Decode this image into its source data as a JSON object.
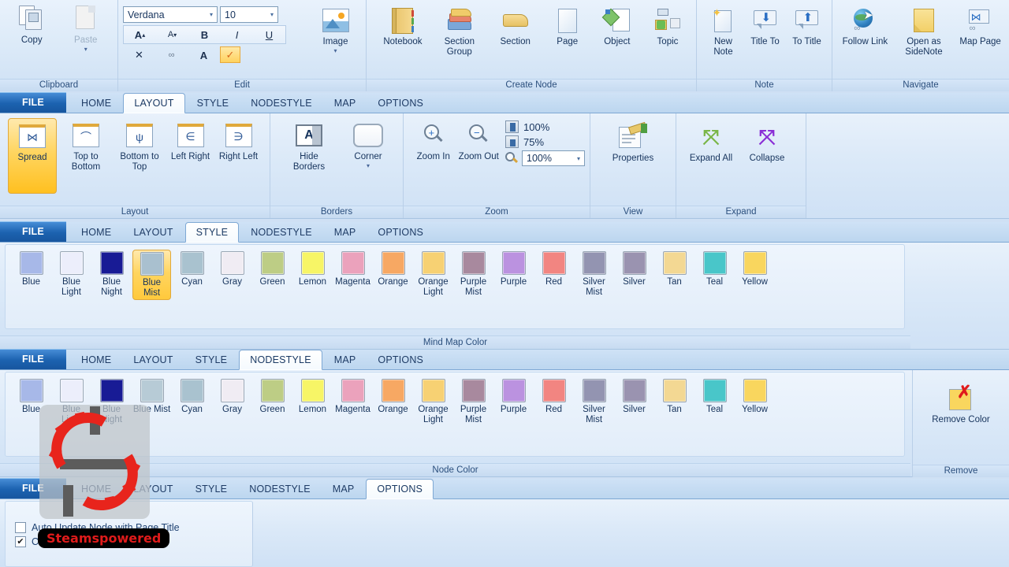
{
  "top_ribbon": {
    "groups": [
      {
        "label": "Clipboard",
        "items": [
          {
            "label": "Copy",
            "icon": "copy-icon",
            "disabled": false
          },
          {
            "label": "Paste",
            "icon": "paste-icon",
            "disabled": true,
            "has_dropdown": true
          }
        ]
      },
      {
        "label": "Edit",
        "font_name": "Verdana",
        "font_size": "10",
        "buttons": [
          {
            "name": "grow-font",
            "glyph": "A˘"
          },
          {
            "name": "shrink-font",
            "glyph": "A˘"
          },
          {
            "name": "bold",
            "glyph": "B"
          },
          {
            "name": "italic",
            "glyph": "I"
          },
          {
            "name": "underline",
            "glyph": "U"
          },
          {
            "name": "delete",
            "glyph": "✕"
          },
          {
            "name": "link",
            "glyph": "∞"
          },
          {
            "name": "font-color",
            "glyph": "A"
          },
          {
            "name": "check",
            "glyph": "✓",
            "selected": true
          }
        ],
        "image_label": "Image"
      },
      {
        "label": "Create Node",
        "items": [
          {
            "label": "Notebook",
            "icon": "notebook-icon"
          },
          {
            "label": "Section Group",
            "icon": "section-group-icon"
          },
          {
            "label": "Section",
            "icon": "section-icon"
          },
          {
            "label": "Page",
            "icon": "page-icon"
          },
          {
            "label": "Object",
            "icon": "object-icon"
          },
          {
            "label": "Topic",
            "icon": "topic-icon"
          }
        ]
      },
      {
        "label": "Note",
        "items": [
          {
            "label": "New Note",
            "icon": "new-note-icon"
          },
          {
            "label": "Title To",
            "icon": "title-to-icon"
          },
          {
            "label": "To Title",
            "icon": "to-title-icon"
          }
        ]
      },
      {
        "label": "Navigate",
        "items": [
          {
            "label": "Follow Link",
            "icon": "follow-link-icon"
          },
          {
            "label": "Open as SideNote",
            "icon": "open-as-sidenote-icon"
          },
          {
            "label": "Map Page",
            "icon": "map-page-icon"
          }
        ]
      }
    ]
  },
  "tabs": [
    "FILE",
    "HOME",
    "LAYOUT",
    "STYLE",
    "NODESTYLE",
    "MAP",
    "OPTIONS"
  ],
  "layout_ribbon": {
    "active_tab": "LAYOUT",
    "groups": [
      {
        "label": "Layout",
        "items": [
          {
            "label": "Spread",
            "icon": "spread-icon",
            "selected": true
          },
          {
            "label": "Top to Bottom",
            "icon": "top-to-bottom-icon"
          },
          {
            "label": "Bottom to Top",
            "icon": "bottom-to-top-icon"
          },
          {
            "label": "Left Right",
            "icon": "left-right-icon"
          },
          {
            "label": "Right Left",
            "icon": "right-left-icon"
          }
        ]
      },
      {
        "label": "Borders",
        "items": [
          {
            "label": "Hide Borders",
            "icon": "hide-borders-icon"
          },
          {
            "label": "Corner",
            "icon": "corner-icon",
            "has_dropdown": true
          }
        ]
      },
      {
        "label": "Zoom",
        "items": [
          {
            "label": "Zoom In",
            "icon": "zoom-in-icon"
          },
          {
            "label": "Zoom Out",
            "icon": "zoom-out-icon"
          }
        ],
        "presets": [
          {
            "label": "100%",
            "icon": "one-page-icon"
          },
          {
            "label": "75%",
            "icon": "page-width-icon"
          }
        ],
        "zoom_combo_value": "100%",
        "zoom_combo_icon": "magnifier-icon"
      },
      {
        "label": "View",
        "items": [
          {
            "label": "Properties",
            "icon": "properties-icon"
          }
        ]
      },
      {
        "label": "Expand",
        "items": [
          {
            "label": "Expand All",
            "icon": "expand-all-icon"
          },
          {
            "label": "Collapse",
            "icon": "collapse-icon"
          }
        ]
      }
    ]
  },
  "style_ribbon": {
    "active_tab": "STYLE",
    "group_label": "Mind Map Color",
    "colors": [
      {
        "name": "Blue",
        "hex": "#a7b8e8"
      },
      {
        "name": "Blue Light",
        "hex": "#eceefb"
      },
      {
        "name": "Blue Night",
        "hex": "#181b95"
      },
      {
        "name": "Blue Mist",
        "hex": "#a9c0cf",
        "selected": true
      },
      {
        "name": "Cyan",
        "hex": "#a9c2cf"
      },
      {
        "name": "Gray",
        "hex": "#f0ecf3"
      },
      {
        "name": "Green",
        "hex": "#bdcd85"
      },
      {
        "name": "Lemon",
        "hex": "#f7f566"
      },
      {
        "name": "Magenta",
        "hex": "#eba2bc"
      },
      {
        "name": "Orange",
        "hex": "#f7a863"
      },
      {
        "name": "Orange Light",
        "hex": "#f7d173"
      },
      {
        "name": "Purple Mist",
        "hex": "#a8899e"
      },
      {
        "name": "Purple",
        "hex": "#bb92e0"
      },
      {
        "name": "Red",
        "hex": "#f28581"
      },
      {
        "name": "Silver Mist",
        "hex": "#9394b1"
      },
      {
        "name": "Silver",
        "hex": "#9a93b0"
      },
      {
        "name": "Tan",
        "hex": "#f3d893"
      },
      {
        "name": "Teal",
        "hex": "#49c6c9"
      },
      {
        "name": "Yellow",
        "hex": "#f9d65e"
      }
    ]
  },
  "nodestyle_ribbon": {
    "active_tab": "NODESTYLE",
    "group_label": "Node Color",
    "remove_group_label": "Remove",
    "remove_button_label": "Remove Color",
    "remove_button_icon": "remove-color-icon",
    "colors": [
      {
        "name": "Blue",
        "hex": "#a7b8e8"
      },
      {
        "name": "Blue Light",
        "hex": "#eceefb"
      },
      {
        "name": "Blue Night",
        "hex": "#181b95"
      },
      {
        "name": "Blue Mist",
        "hex": "#b7cbd6"
      },
      {
        "name": "Cyan",
        "hex": "#a9c2cf"
      },
      {
        "name": "Gray",
        "hex": "#f0ecf3"
      },
      {
        "name": "Green",
        "hex": "#bdcd85"
      },
      {
        "name": "Lemon",
        "hex": "#f7f566"
      },
      {
        "name": "Magenta",
        "hex": "#eba2bc"
      },
      {
        "name": "Orange",
        "hex": "#f7a863"
      },
      {
        "name": "Orange Light",
        "hex": "#f7d173"
      },
      {
        "name": "Purple Mist",
        "hex": "#a8899e"
      },
      {
        "name": "Purple",
        "hex": "#bb92e0"
      },
      {
        "name": "Red",
        "hex": "#f28581"
      },
      {
        "name": "Silver Mist",
        "hex": "#9394b1"
      },
      {
        "name": "Silver",
        "hex": "#9a93b0"
      },
      {
        "name": "Tan",
        "hex": "#f3d893"
      },
      {
        "name": "Teal",
        "hex": "#49c6c9"
      },
      {
        "name": "Yellow",
        "hex": "#f9d65e"
      }
    ]
  },
  "options_ribbon": {
    "active_tab": "OPTIONS",
    "checkboxes": [
      {
        "label": "Auto Update Node with Page Title",
        "checked": false
      },
      {
        "label": "Create Node Comments",
        "checked": true
      }
    ]
  },
  "watermark": {
    "label": "Steamspowered",
    "icon": "gears-icon",
    "label_color": "#e01b1b",
    "label_bg": "#000000"
  }
}
